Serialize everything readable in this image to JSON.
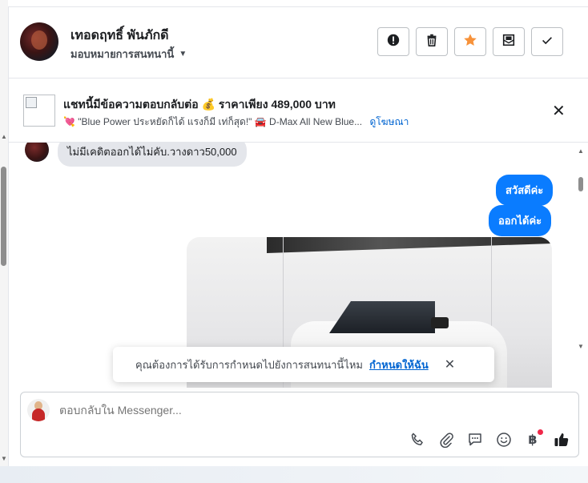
{
  "header": {
    "contact_name": "เทอดฤทธิ์ พันภักดี",
    "assign_label": "มอบหมายการสนทนานี้",
    "actions": [
      {
        "name": "spam-button",
        "icon": "alert-circle-icon"
      },
      {
        "name": "delete-button",
        "icon": "trash-icon"
      },
      {
        "name": "star-button",
        "icon": "star-icon"
      },
      {
        "name": "mark-unread-button",
        "icon": "open-envelope-icon"
      },
      {
        "name": "done-button",
        "icon": "check-icon"
      }
    ]
  },
  "ad_banner": {
    "title": "แชทนี้มีข้อความตอบกลับต่อ 💰 ราคาเพียง 489,000 บาท",
    "subtitle": "💘 \"Blue Power ประหยัดก็ได้ แรงก็มี เท่ก็สุด!\" 🚘 D-Max All New Blue...",
    "link_label": "ดูโฆษณา"
  },
  "messages": {
    "incoming": [
      {
        "text": "ไม่มีเคดิตออกได้ไม่คับ.วางดาว50,000"
      }
    ],
    "outgoing": [
      {
        "text": "สวัสดีค่ะ"
      },
      {
        "text": "ออกได้ค่ะ"
      }
    ]
  },
  "assign_toast": {
    "text": "คุณต้องการได้รับการกำหนดไปยังการสนทนานี้ไหม",
    "link": "กำหนดให้ฉัน"
  },
  "composer": {
    "placeholder": "ตอบกลับใน Messenger...",
    "tools": [
      "phone-icon",
      "paperclip-icon",
      "saved-reply-icon",
      "emoji-icon",
      "baht-payment-icon",
      "thumbs-up-icon"
    ],
    "baht_symbol": "฿"
  },
  "colors": {
    "accent": "#0a7cff",
    "star": "#f7923a",
    "link": "#0064d1",
    "notification_dot": "#f02849"
  }
}
